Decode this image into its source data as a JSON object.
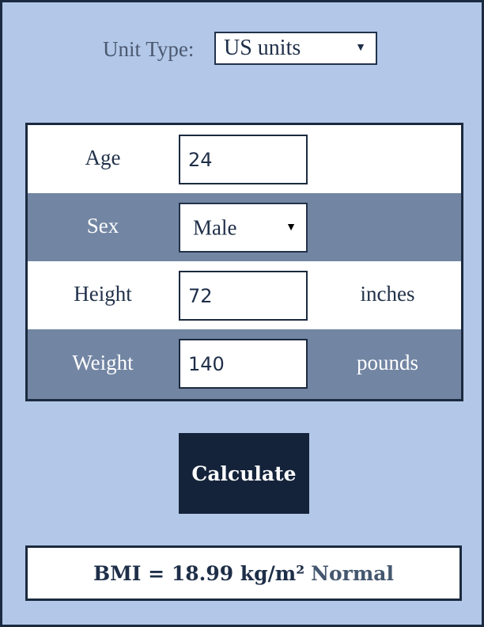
{
  "unit_type": {
    "label": "Unit Type:",
    "selected": "US units"
  },
  "form": {
    "age": {
      "label": "Age",
      "value": "24"
    },
    "sex": {
      "label": "Sex",
      "selected": "Male"
    },
    "height": {
      "label": "Height",
      "value": "72",
      "unit": "inches"
    },
    "weight": {
      "label": "Weight",
      "value": "140",
      "unit": "pounds"
    }
  },
  "calculate_label": "Calculate",
  "result": {
    "text": "BMI = 18.99 kg/m² ",
    "category": "Normal"
  },
  "colors": {
    "background": "#b3c8e8",
    "row_alt": "#7285a3",
    "button": "#14233a",
    "border": "#1b2a3f"
  },
  "icons": {
    "dropdown": "caret-down-icon"
  }
}
